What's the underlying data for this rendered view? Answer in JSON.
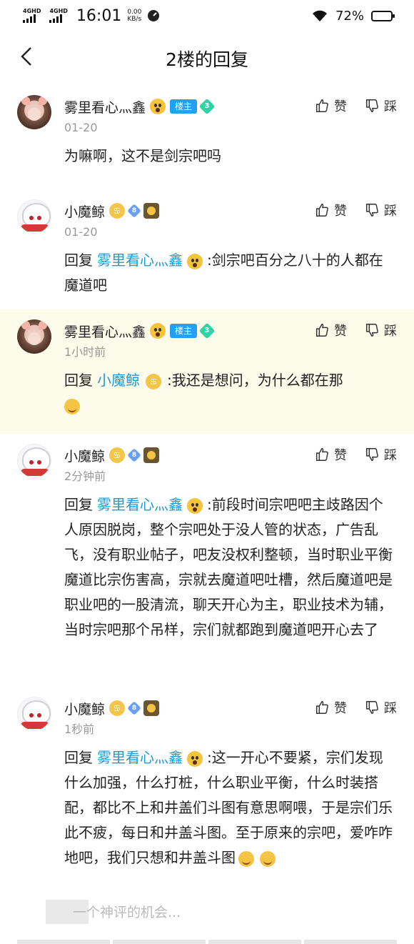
{
  "status_bar": {
    "sim1": "4GHD",
    "sim2": "4GHD",
    "time": "16:01",
    "speed_value": "0.00",
    "speed_unit": "KB/s",
    "battery_text": "72%",
    "battery_level": 0.72
  },
  "nav": {
    "title": "2楼的回复"
  },
  "actions": {
    "like": "赞",
    "dislike": "踩"
  },
  "replies": [
    {
      "name": "雾里看心灬鑫",
      "badge_owner": "楼主",
      "level": "3",
      "time": "01-20",
      "prefix": "",
      "mention": "",
      "text": "为嘛啊，这不是剑宗吧吗"
    },
    {
      "name": "小魔鲸",
      "level": "8",
      "time": "01-20",
      "prefix": "回复",
      "mention": "雾里看心灬鑫",
      "text": ":剑宗吧百分之八十的人都在魔道吧"
    },
    {
      "name": "雾里看心灬鑫",
      "badge_owner": "楼主",
      "level": "3",
      "time": "1小时前",
      "prefix": "回复",
      "mention": "小魔鲸",
      "text": ":我还是想问，为什么都在那"
    },
    {
      "name": "小魔鲸",
      "level": "8",
      "time": "2分钟前",
      "prefix": "回复",
      "mention": "雾里看心灬鑫",
      "text": ":前段时间宗吧吧主歧路因个人原因脱岗，整个宗吧处于没人管的状态，广告乱飞，没有职业帖子，吧友没权利整顿，当时职业平衡魔道比宗伤害高，宗就去魔道吧吐槽，然后魔道吧是职业吧的一股清流，聊天开心为主，职业技术为辅，当时宗吧那个吊样，宗们就都跑到魔道吧开心去了"
    },
    {
      "name": "小魔鲸",
      "level": "8",
      "time": "1秒前",
      "prefix": "回复",
      "mention": "雾里看心灬鑫",
      "text": ":这一开心不要紧，宗们发现什么加强，什么打桩，什么职业平衡，什么时装搭配，都比不上和井盖们斗图有意思啊喂，于是宗们乐此不疲，每日和井盖斗图。至于原来的宗吧，爱咋咋地吧，我们只想和井盖斗图"
    }
  ],
  "input": {
    "placeholder": "一个神评的机会..."
  }
}
